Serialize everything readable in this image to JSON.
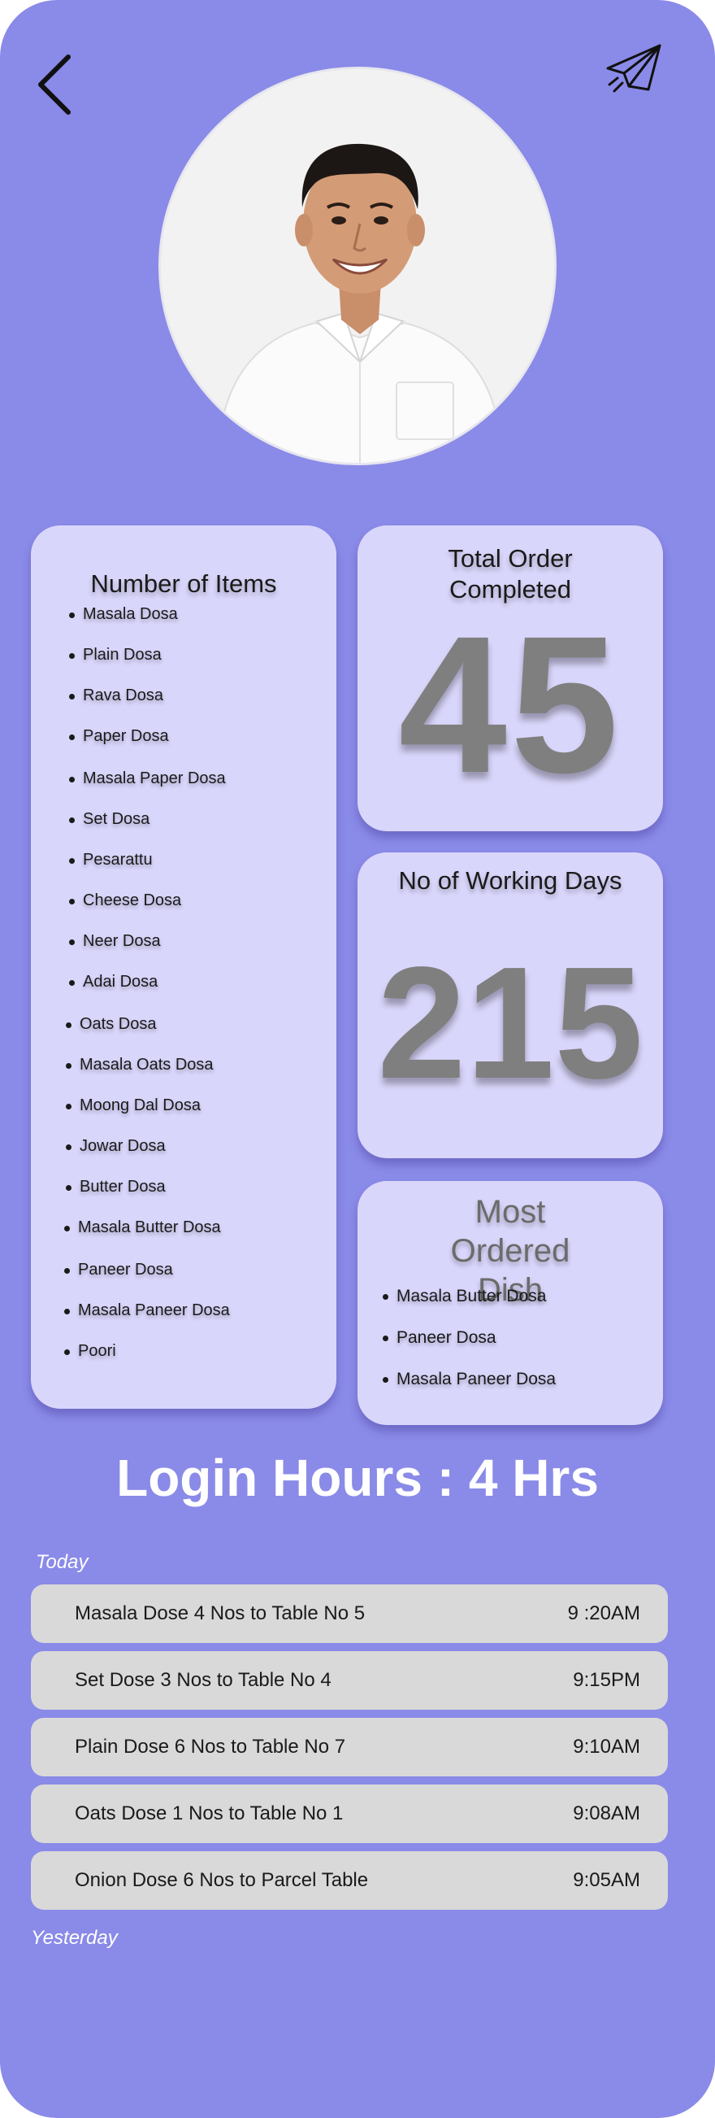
{
  "header": {
    "back_icon": "chevron-left-icon",
    "send_icon": "paper-plane-icon"
  },
  "profile": {
    "avatar": "profile-photo"
  },
  "items_card": {
    "title": "Number of Items",
    "items": [
      "Masala Dosa",
      "Plain Dosa",
      "Rava Dosa",
      "Paper Dosa",
      "Masala Paper Dosa",
      "Set Dosa",
      "Pesarattu",
      "Cheese Dosa",
      "Neer Dosa",
      "Adai Dosa",
      "Oats Dosa",
      "Masala Oats Dosa",
      "Moong Dal Dosa",
      "Jowar Dosa",
      "Butter Dosa",
      "Masala Butter Dosa",
      "Paneer Dosa",
      "Masala Paneer Dosa",
      "Poori"
    ]
  },
  "total_orders": {
    "title": "Total Order Completed",
    "value": "45"
  },
  "working_days": {
    "title": "No of Working Days",
    "value": "215"
  },
  "most_ordered": {
    "title": "Most Ordered Dish",
    "items": [
      "Masala Butter Dosa",
      "Paneer Dosa",
      "Masala Paneer Dosa"
    ]
  },
  "login_hours": "Login Hours : 4 Hrs",
  "today_label": "Today",
  "yesterday_label": "Yesterday",
  "orders": [
    {
      "text": "Masala Dose 4 Nos to Table No 5",
      "time": "9 :20AM"
    },
    {
      "text": "Set Dose 3 Nos to Table No 4",
      "time": "9:15PM"
    },
    {
      "text": "Plain Dose 6 Nos to Table No 7",
      "time": "9:10AM"
    },
    {
      "text": "Oats Dose 1 Nos to Table No 1",
      "time": "9:08AM"
    },
    {
      "text": "Onion Dose 6 Nos to Parcel Table",
      "time": "9:05AM"
    }
  ],
  "colors": {
    "background": "#8a8ae8",
    "card": "#d9d6fb",
    "big_number": "#7f7f7f",
    "order_row": "#d9d9d9"
  }
}
